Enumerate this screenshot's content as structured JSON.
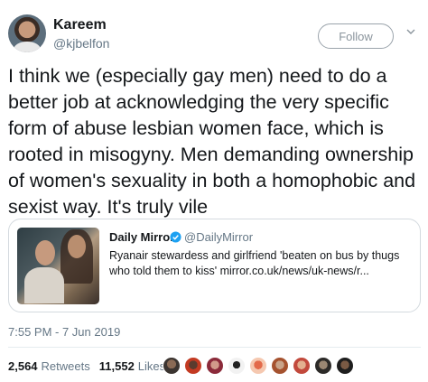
{
  "author": {
    "display_name": "Kareem",
    "handle": "@kjbelfon"
  },
  "follow_label": "Follow",
  "tweet_text": "I think we (especially gay men) need to do a better job at acknowledging the very specific form of abuse lesbian women face, which is rooted in misogyny. Men demanding ownership of women's sexuality in both a homophobic and sexist way. It's truly vile",
  "quote": {
    "name": "Daily Mirror",
    "handle": "@DailyMirror",
    "verified": true,
    "text": "Ryanair stewardess and girlfriend 'beaten on bus by thugs who told them to kiss' mirror.co.uk/news/uk-news/r..."
  },
  "timestamp": "7:55 PM - 7 Jun 2019",
  "stats": {
    "retweets_count": "2,564",
    "retweets_label": "Retweets",
    "likes_count": "11,552",
    "likes_label": "Likes"
  },
  "colors": {
    "accent": "#1da1f2",
    "secondary_text": "#657786",
    "primary_text": "#14171a"
  },
  "liker_avatars": [
    "liker-1",
    "liker-2",
    "liker-3",
    "liker-4",
    "liker-5",
    "liker-6",
    "liker-7",
    "liker-8",
    "liker-9"
  ]
}
